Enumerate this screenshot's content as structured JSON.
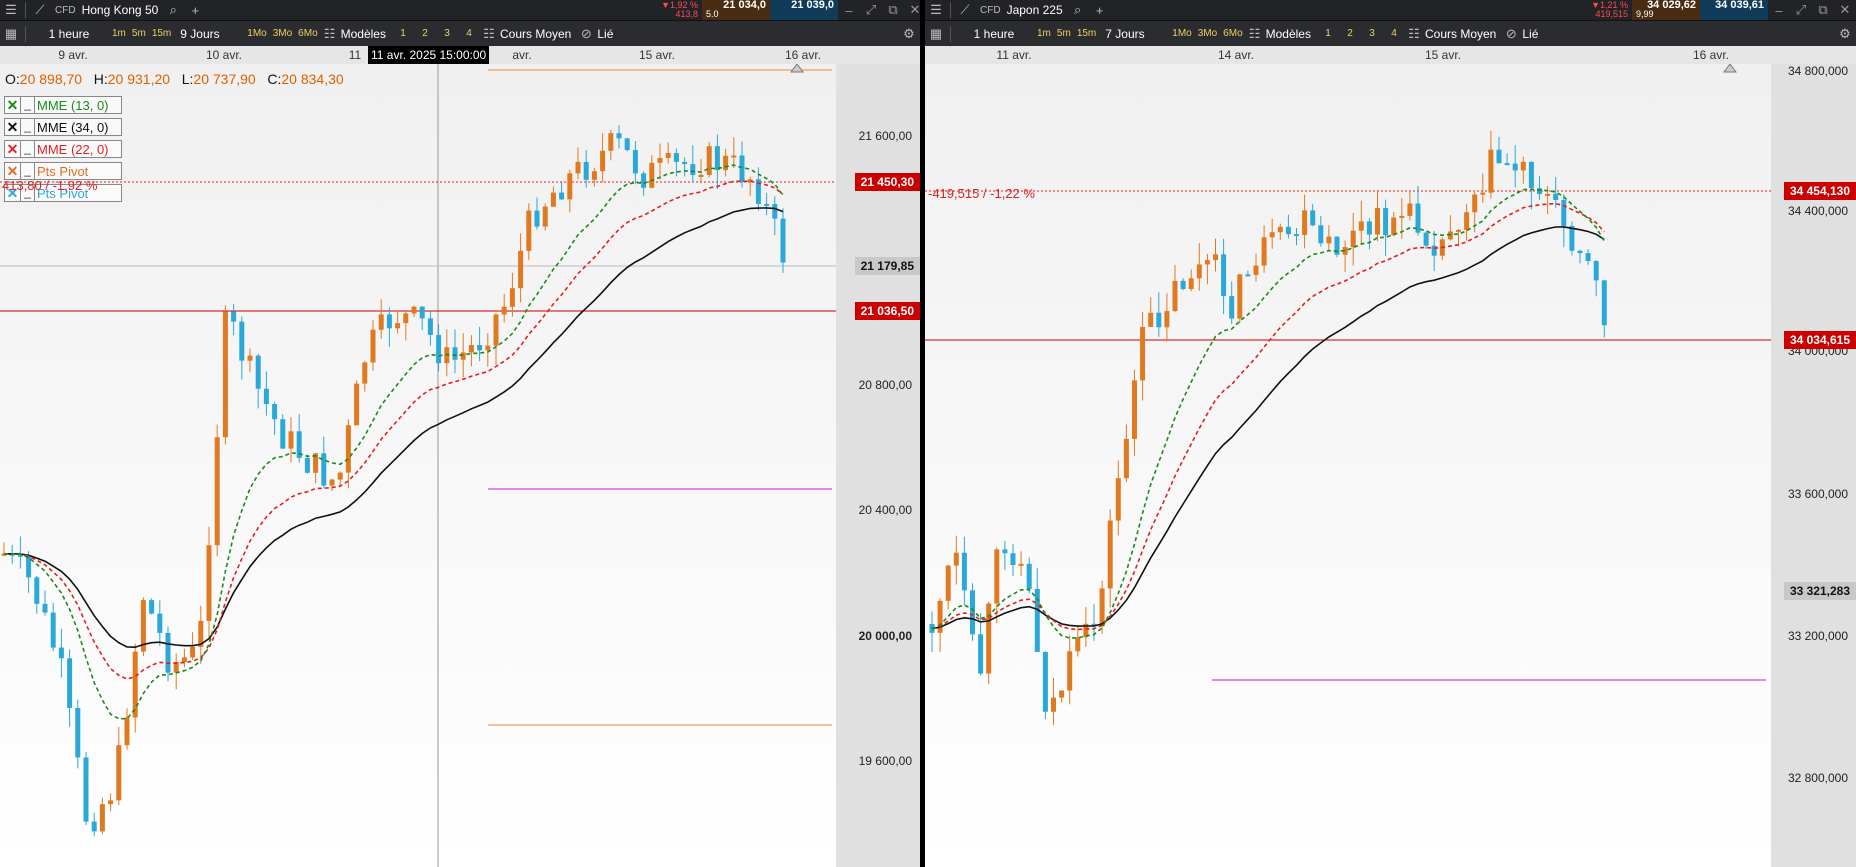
{
  "left": {
    "instrument_type": "CFD",
    "instrument": "Hong Kong 50",
    "change_pct": "▼1,92 %",
    "change_abs": "413,8",
    "bid": "21 034,0",
    "ask": "21 039,0",
    "spread": "5.0",
    "toolbar": {
      "interval": "1 heure",
      "quick_intervals": [
        "1m",
        "5m",
        "15m"
      ],
      "range": "9 Jours",
      "quick_ranges": [
        "1Mo",
        "3Mo",
        "6Mo"
      ],
      "models": "Modèles",
      "layouts": [
        "1",
        "2",
        "3",
        "4"
      ],
      "price_type": "Cours Moyen",
      "link": "Lié"
    },
    "dates": [
      "9 avr.",
      "10 avr.",
      "11",
      "avr.",
      "15 avr.",
      "16 avr."
    ],
    "crosshair_date": "11 avr. 2025 15:00:00",
    "ohlc": {
      "o_label": "O:",
      "o": "20 898,70",
      "h_label": "H:",
      "h": "20 931,20",
      "l_label": "L:",
      "l": "20 737,90",
      "c_label": "C:",
      "c": "20 834,30"
    },
    "legend": [
      {
        "mark": "✕",
        "u": "_",
        "label": "MME (13, 0)",
        "color": "#1a8a1a"
      },
      {
        "mark": "✕",
        "u": "_",
        "label": "MME (34, 0)",
        "color": "#111111"
      },
      {
        "mark": "✕",
        "u": "_",
        "label": "MME (22, 0)",
        "color": "#e02020"
      },
      {
        "mark": "✕",
        "u": "_",
        "label": "Pts Pivot",
        "color": "#e07020"
      },
      {
        "mark": "✕",
        "u": "_",
        "label": "Pts Pivot",
        "color": "#2aa8d8"
      }
    ],
    "pct_label": "413,80 / -1,92 %",
    "axis": [
      "21 600,00",
      "20 800,00",
      "20 400,00",
      "20 000,00",
      "19 600,00"
    ],
    "tags": {
      "prev_close": "21 450,30",
      "crosshair": "21 179,85",
      "current": "21 036,50"
    }
  },
  "right": {
    "instrument_type": "CFD",
    "instrument": "Japon 225",
    "change_pct": "▼1,21 %",
    "change_abs": "419,515",
    "bid": "34 029,62",
    "ask": "34 039,61",
    "spread": "9,99",
    "toolbar": {
      "interval": "1 heure",
      "quick_intervals": [
        "1m",
        "5m",
        "15m"
      ],
      "range": "7 Jours",
      "quick_ranges": [
        "1Mo",
        "3Mo",
        "6Mo"
      ],
      "models": "Modèles",
      "layouts": [
        "1",
        "2",
        "3",
        "4"
      ],
      "price_type": "Cours Moyen",
      "link": "Lié"
    },
    "dates": [
      "11 avr.",
      "14 avr.",
      "15 avr.",
      "16 avr."
    ],
    "pct_label": "-419,515 / -1,22 %",
    "axis": [
      "34 800,000",
      "34 400,000",
      "34 000,000",
      "33 600,000",
      "33 200,000",
      "32 800,000"
    ],
    "tags": {
      "prev_close": "34 454,130",
      "current": "34 034,615",
      "marker": "33 321,283"
    }
  },
  "colors": {
    "bull": "#2aa8d8",
    "bear": "#e07a20",
    "ema13": "#1a8a1a",
    "ema22": "#e02020",
    "ema34": "#111111",
    "pivot_r": "#e8a060",
    "pivot_s": "#e060e0"
  }
}
